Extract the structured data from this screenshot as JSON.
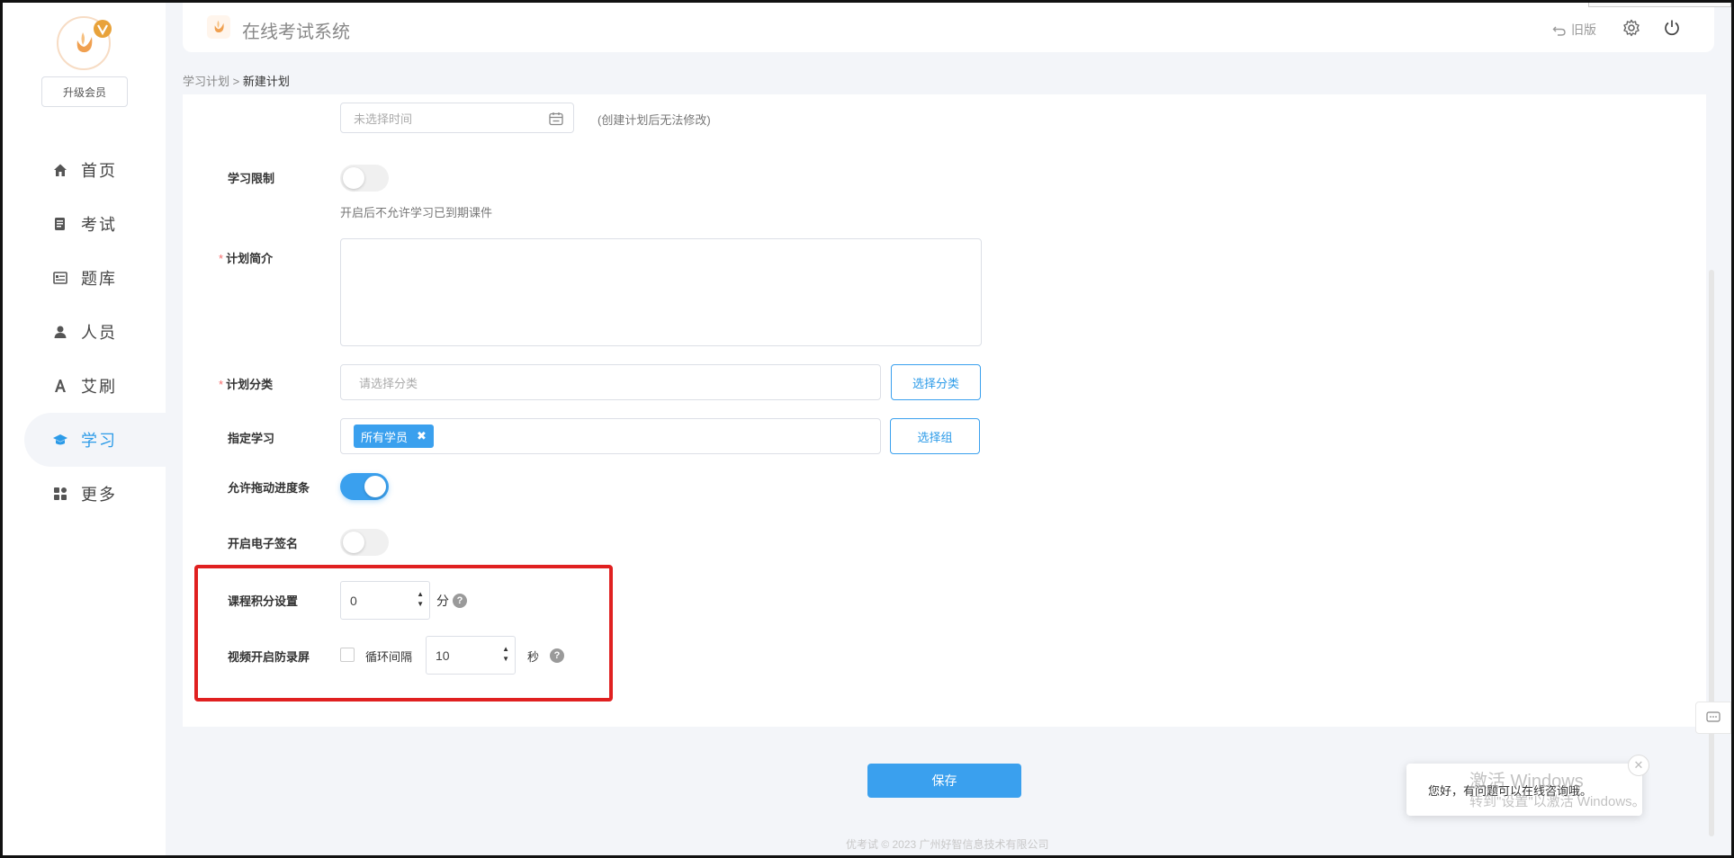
{
  "app": {
    "title": "在线考试系统"
  },
  "sidebar": {
    "upgrade_label": "升级会员",
    "items": [
      {
        "label": "首页",
        "icon": "home-icon"
      },
      {
        "label": "考试",
        "icon": "exam-icon"
      },
      {
        "label": "题库",
        "icon": "question-bank-icon"
      },
      {
        "label": "人员",
        "icon": "user-icon"
      },
      {
        "label": "艾刷",
        "icon": "letter-a-icon"
      },
      {
        "label": "学习",
        "icon": "graduation-cap-icon",
        "active": true
      },
      {
        "label": "更多",
        "icon": "grid-icon"
      }
    ]
  },
  "header": {
    "old_version": "旧版"
  },
  "breadcrumb": {
    "parent": "学习计划",
    "separator": ">",
    "current": "新建计划"
  },
  "form": {
    "time_placeholder": "未选择时间",
    "time_hint": "(创建计划后无法修改)",
    "study_limit_label": "学习限制",
    "study_limit_hint": "开启后不允许学习已到期课件",
    "intro_label": "计划简介",
    "category_label": "计划分类",
    "category_placeholder": "请选择分类",
    "category_button": "选择分类",
    "assign_label": "指定学习",
    "assign_tag": "所有学员",
    "assign_button": "选择组",
    "drag_progress_label": "允许拖动进度条",
    "esign_label": "开启电子签名",
    "score_label": "课程积分设置",
    "score_value": "0",
    "score_unit": "分",
    "anti_record_label": "视频开启防录屏",
    "loop_label": "循环间隔",
    "loop_value": "10",
    "loop_unit": "秒"
  },
  "save_label": "保存",
  "footer": "优考试 © 2023 广州好智信息技术有限公司",
  "chat": {
    "message": "您好，有问题可以在线咨询哦。"
  },
  "watermark": {
    "line1": "激活 Windows",
    "line2": "转到\"设置\"以激活 Windows。"
  },
  "colors": {
    "accent": "#3aa0ee",
    "required": "#f56c6c",
    "highlight": "#e02020"
  }
}
